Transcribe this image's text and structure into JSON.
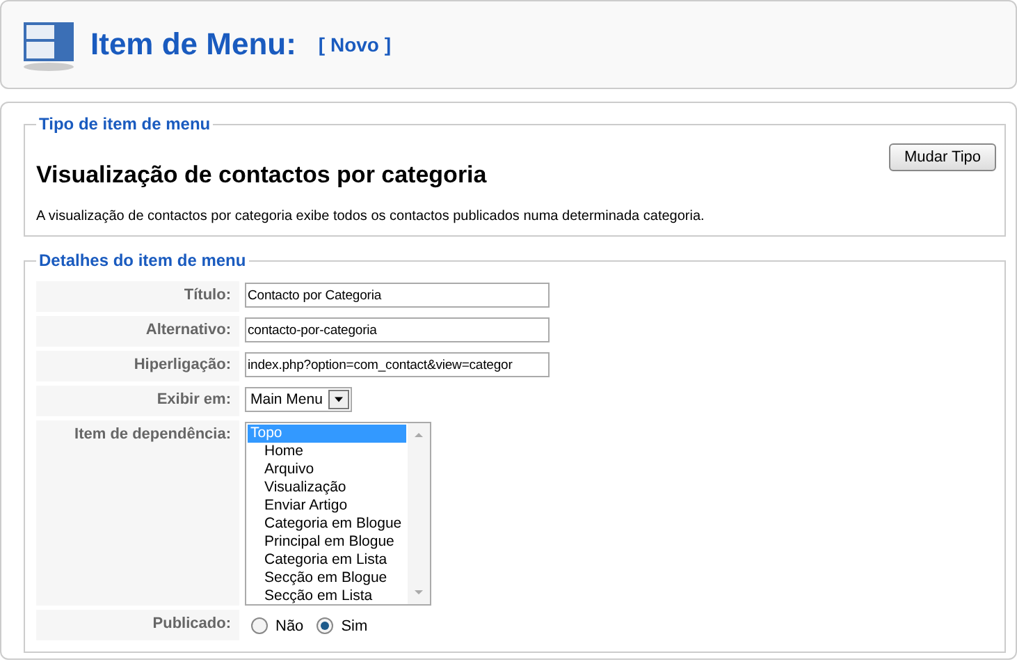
{
  "header": {
    "title": "Item de Menu:",
    "subtitle": "[ Novo ]"
  },
  "type_section": {
    "legend": "Tipo de item de menu",
    "heading": "Visualização de contactos por categoria",
    "button": "Mudar Tipo",
    "description": "A visualização de contactos por categoria exibe todos os contactos publicados numa determinada categoria."
  },
  "details_section": {
    "legend": "Detalhes do item de menu",
    "rows": [
      {
        "kind": "text",
        "label": "Título:",
        "value": "Contacto por Categoria"
      },
      {
        "kind": "text",
        "label": "Alternativo:",
        "value": "contacto-por-categoria"
      },
      {
        "kind": "text",
        "label": "Hiperligação:",
        "value": "index.php?option=com_contact&view=categor"
      },
      {
        "kind": "select",
        "label": "Exibir em:",
        "value": "Main Menu"
      },
      {
        "kind": "listbox",
        "label": "Item de dependência:",
        "options": [
          {
            "label": "Topo",
            "selected": true,
            "children": [
              {
                "label": "Home",
                "selected": false
              },
              {
                "label": "Arquivo",
                "selected": false
              },
              {
                "label": "Visualização",
                "selected": false
              },
              {
                "label": "Enviar Artigo",
                "selected": false
              },
              {
                "label": "Categoria em Blogue",
                "selected": false
              },
              {
                "label": "Principal em Blogue",
                "selected": false
              },
              {
                "label": "Categoria em Lista",
                "selected": false
              },
              {
                "label": "Secção em Blogue",
                "selected": false
              },
              {
                "label": "Secção em Lista",
                "selected": false
              }
            ]
          }
        ]
      },
      {
        "kind": "radio",
        "label": "Publicado:",
        "options": [
          {
            "label": "Não",
            "selected": false
          },
          {
            "label": "Sim",
            "selected": true
          }
        ]
      }
    ]
  }
}
